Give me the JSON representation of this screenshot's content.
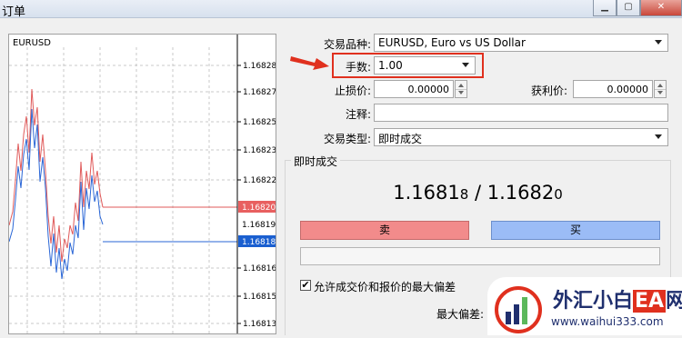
{
  "window": {
    "title": "订单",
    "minimize_icon": "minimize-icon",
    "maximize_icon": "maximize-icon",
    "close_icon": "close-icon"
  },
  "chart": {
    "symbol": "EURUSD",
    "price_ticks": [
      "1.16828",
      "1.16827",
      "1.16825",
      "1.16823",
      "1.16822",
      "1.16816",
      "1.16815",
      "1.16813"
    ],
    "bid_marker": "1.16820",
    "ask_marker": "1.16818",
    "overlap_tick": "1.16819",
    "bid_color": "#e05a5a",
    "ask_color": "#2a66d6",
    "marker_bid_bg": "#e86060",
    "marker_ask_bg": "#1a5fd0"
  },
  "form": {
    "symbol_label": "交易品种:",
    "symbol_value": "EURUSD, Euro vs US Dollar",
    "volume_label": "手数:",
    "volume_value": "1.00",
    "stoploss_label": "止损价:",
    "stoploss_value": "0.00000",
    "takeprofit_label": "获利价:",
    "takeprofit_value": "0.00000",
    "comment_label": "注释:",
    "comment_value": "",
    "type_label": "交易类型:",
    "type_value": "即时成交"
  },
  "execution": {
    "group_title": "即时成交",
    "bid_main": "1.1681",
    "bid_last": "8",
    "separator": " / ",
    "ask_main": "1.1682",
    "ask_last": "0",
    "sell_label": "卖",
    "buy_label": "买",
    "deviation_checkbox_label": "允许成交价和报价的最大偏差",
    "deviation_checked": true,
    "max_deviation_label": "最大偏差:"
  },
  "watermark": {
    "brand_main": "外汇小白",
    "brand_ea": "EA",
    "brand_tail": "网",
    "url": "www.waihui333.com"
  },
  "colors": {
    "highlight": "#e0301e",
    "sell": "#f28b8b",
    "buy": "#9bbcf6"
  }
}
